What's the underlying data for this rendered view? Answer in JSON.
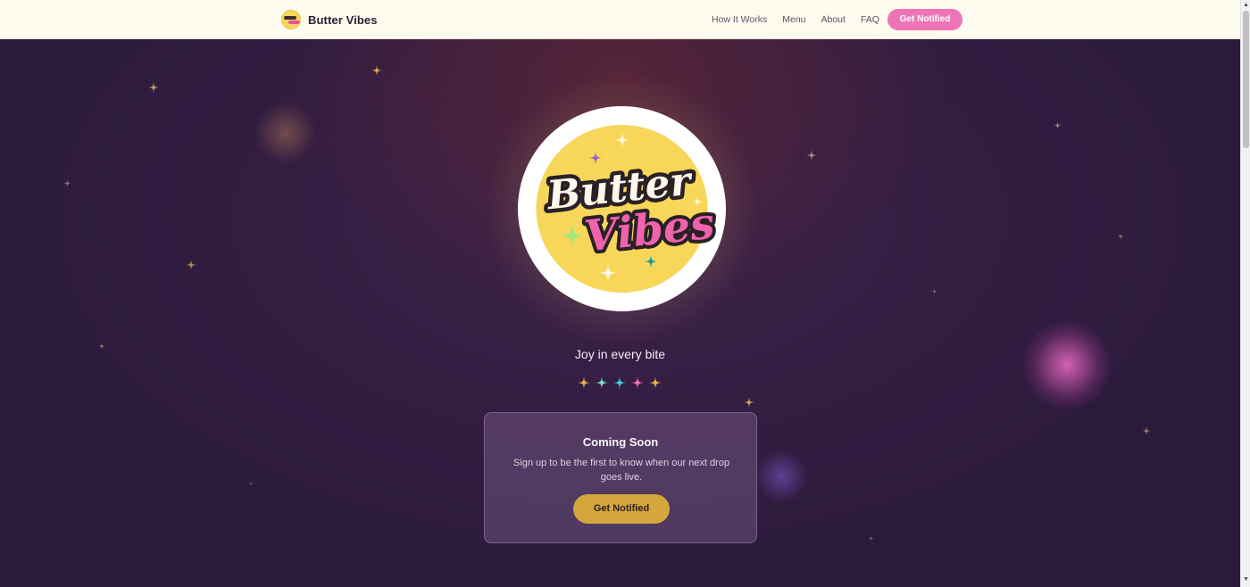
{
  "nav": {
    "brand": "Butter Vibes",
    "links": [
      "How It Works",
      "Menu",
      "About",
      "FAQ"
    ],
    "cta": "Get Notified"
  },
  "hero": {
    "logo": {
      "line1": "Butter",
      "line2": "Vibes"
    },
    "tagline": "Joy in every bite",
    "star_colors": [
      "#e5b53e",
      "#7ee0c2",
      "#3bd4e6",
      "#ee74b8",
      "#e5b53e"
    ]
  },
  "card": {
    "title": "Coming Soon",
    "text": "Sign up to be the first to know when our next drop goes live.",
    "button": "Get Notified"
  },
  "colors": {
    "nav_bg": "#fdfaee",
    "hero_bg": "#2c1a3e",
    "cta_pink": "#ee74b8",
    "gold": "#d5a63b",
    "logo_yellow": "#f7d65a"
  }
}
